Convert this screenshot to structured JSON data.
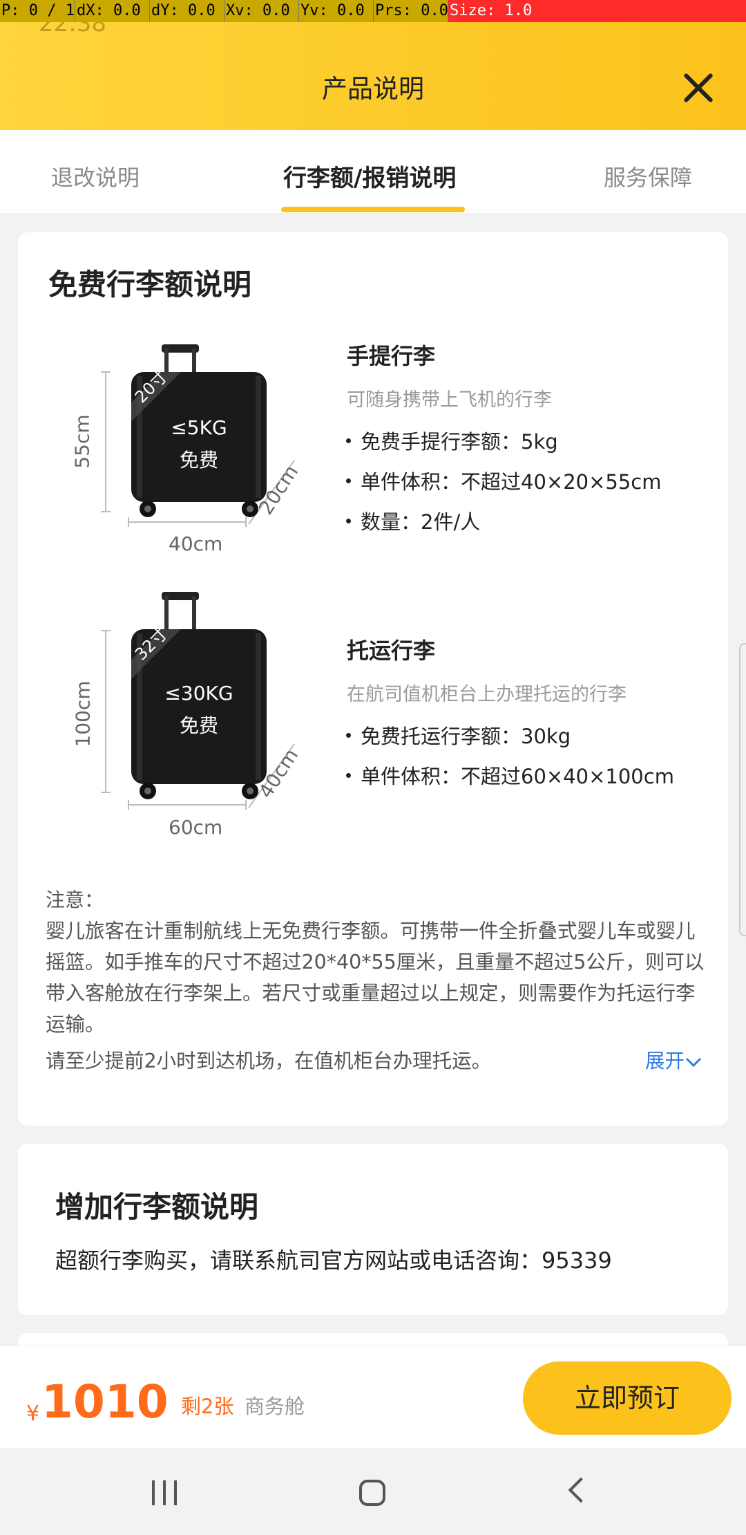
{
  "debug": {
    "p": "P: 0 / 1",
    "dx": "dX: 0.0",
    "dy": "dY: 0.0",
    "xv": "Xv: 0.0",
    "yv": "Yv: 0.0",
    "prs": "Prs: 0.0",
    "size": "Size: 1.0",
    "clock": "22:38"
  },
  "header": {
    "title": "产品说明"
  },
  "tabs": [
    {
      "label": "退改说明"
    },
    {
      "label": "行李额/报销说明"
    },
    {
      "label": "服务保障"
    }
  ],
  "free_baggage": {
    "title": "免费行李额说明",
    "carry_on": {
      "tag": "20寸",
      "weight": "≤5KG",
      "free": "免费",
      "height": "55cm",
      "width": "40cm",
      "depth": "20cm",
      "title": "手提行李",
      "sub": "可随身携带上飞机的行李",
      "bullets": [
        "免费手提行李额：5kg",
        "单件体积：不超过40×20×55cm",
        "数量：2件/人"
      ]
    },
    "checked": {
      "tag": "32寸",
      "weight": "≤30KG",
      "free": "免费",
      "height": "100cm",
      "width": "60cm",
      "depth": "40cm",
      "title": "托运行李",
      "sub": "在航司值机柜台上办理托运的行李",
      "bullets": [
        "免费托运行李额：30kg",
        "单件体积：不超过60×40×100cm"
      ]
    },
    "note_label": "注意：",
    "note_text": "婴儿旅客在计重制航线上无免费行李额。可携带一件全折叠式婴儿车或婴儿摇篮。如手推车的尺寸不超过20*40*55厘米，且重量不超过5公斤，则可以带入客舱放在行李架上。若尺寸或重量超过以上规定，则需要作为托运行李运输。",
    "tip": "请至少提前2小时到达机场，在值机柜台办理托运。",
    "expand": "展开"
  },
  "extra_baggage": {
    "title": "增加行李额说明",
    "desc": "超额行李购买，请联系航司官方网站或电话咨询：95339"
  },
  "bottom": {
    "currency": "¥",
    "price": "1010",
    "remaining": "剩2张",
    "cabin": "商务舱",
    "book": "立即预订"
  },
  "colors": {
    "accent": "#fcc21b",
    "price": "#ff6b1a",
    "link": "#2f7be8"
  }
}
